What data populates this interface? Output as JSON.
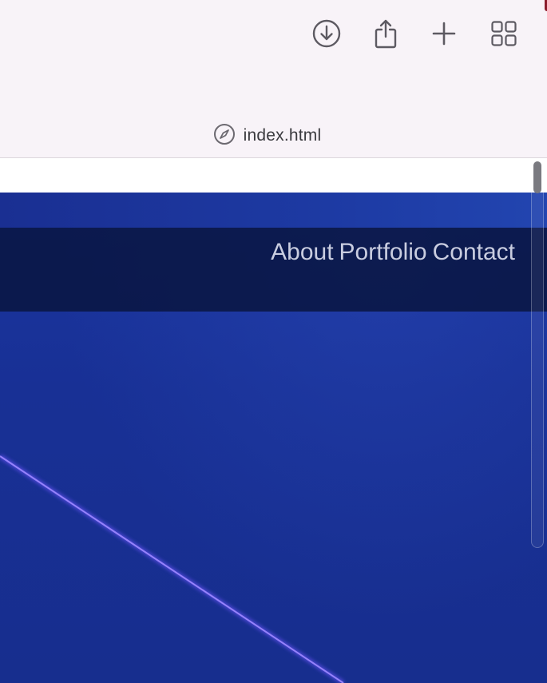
{
  "browser": {
    "address": "index.html",
    "toolbar_icons": [
      "download-icon",
      "share-icon",
      "plus-icon",
      "tab-grid-icon"
    ]
  },
  "page": {
    "nav": {
      "about": "About",
      "portfolio": "Portfolio",
      "contact": "Contact"
    }
  },
  "colors": {
    "chrome_bg": "#f8f3f8",
    "hero_bg": "#183095",
    "nav_bg": "#0b1748",
    "nav_text": "#c9cde0",
    "beam": "#7b5cff"
  }
}
